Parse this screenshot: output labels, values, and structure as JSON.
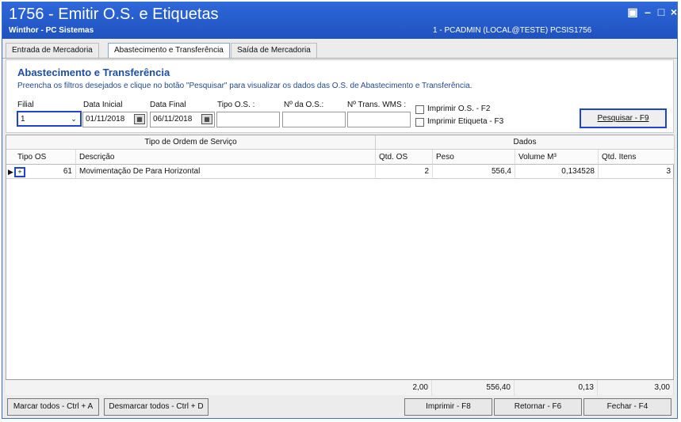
{
  "window": {
    "title": "1756 - Emitir O.S. e Etiquetas",
    "subtitle": "Winthor - PC Sistemas",
    "user_info": "1 - PCADMIN (LOCAL@TESTE)  PCSIS1756"
  },
  "tabs": [
    {
      "label": "Entrada de Mercadoria"
    },
    {
      "label": "Abastecimento e Transferência"
    },
    {
      "label": "Saída de Mercadoria"
    }
  ],
  "filters": {
    "section_title": "Abastecimento e Transferência",
    "instructions": "Preencha os filtros desejados e clique no botão \"Pesquisar\" para visualizar os dados das O.S. de Abastecimento e Transferência.",
    "filial_label": "Filial",
    "filial_value": "1",
    "data_inicial_label": "Data Inicial",
    "data_inicial_value": "01/11/2018",
    "data_final_label": "Data Final",
    "data_final_value": "06/11/2018",
    "tipo_os_label": "Tipo O.S. :",
    "numero_os_label": "Nº da O.S.:",
    "trans_wms_label": "Nº Trans. WMS :",
    "imprimir_os_label": "Imprimir O.S. - F2",
    "imprimir_etiqueta_label": "Imprimir Etiqueta - F3",
    "search_button": "Pesquisar - F9"
  },
  "grid": {
    "group_headers": [
      "Tipo de Ordem de Serviço",
      "Dados"
    ],
    "columns": [
      "Tipo OS",
      "Descrição",
      "Qtd. OS",
      "Peso",
      "Volume M³",
      "Qtd. Itens"
    ],
    "rows": [
      {
        "tipo_os": "61",
        "descricao": "Movimentação De Para Horizontal",
        "qtd_os": "2",
        "peso": "556,4",
        "volume": "0,134528",
        "qtd_itens": "3"
      }
    ],
    "totals": {
      "qtd_os": "2,00",
      "peso": "556,40",
      "volume": "0,13",
      "qtd_itens": "3,00"
    }
  },
  "buttons": {
    "marcar_todos": "Marcar todos - Ctrl + A",
    "desmarcar_todos": "Desmarcar todos - Ctrl + D",
    "imprimir": "Imprimir - F8",
    "retornar": "Retornar - F6",
    "fechar": "Fechar - F4"
  },
  "icons": {
    "restore": "restore-icon",
    "minimize": "minimize-icon",
    "maximize": "maximize-icon",
    "close": "close-icon",
    "calendar": "calendar-icon",
    "dropdown": "chevron-down-icon",
    "expand": "plus-icon"
  },
  "colors": {
    "title_bar": "#2e67d9",
    "highlight_border": "#1e45d1",
    "section_title": "#1f4ea5"
  }
}
